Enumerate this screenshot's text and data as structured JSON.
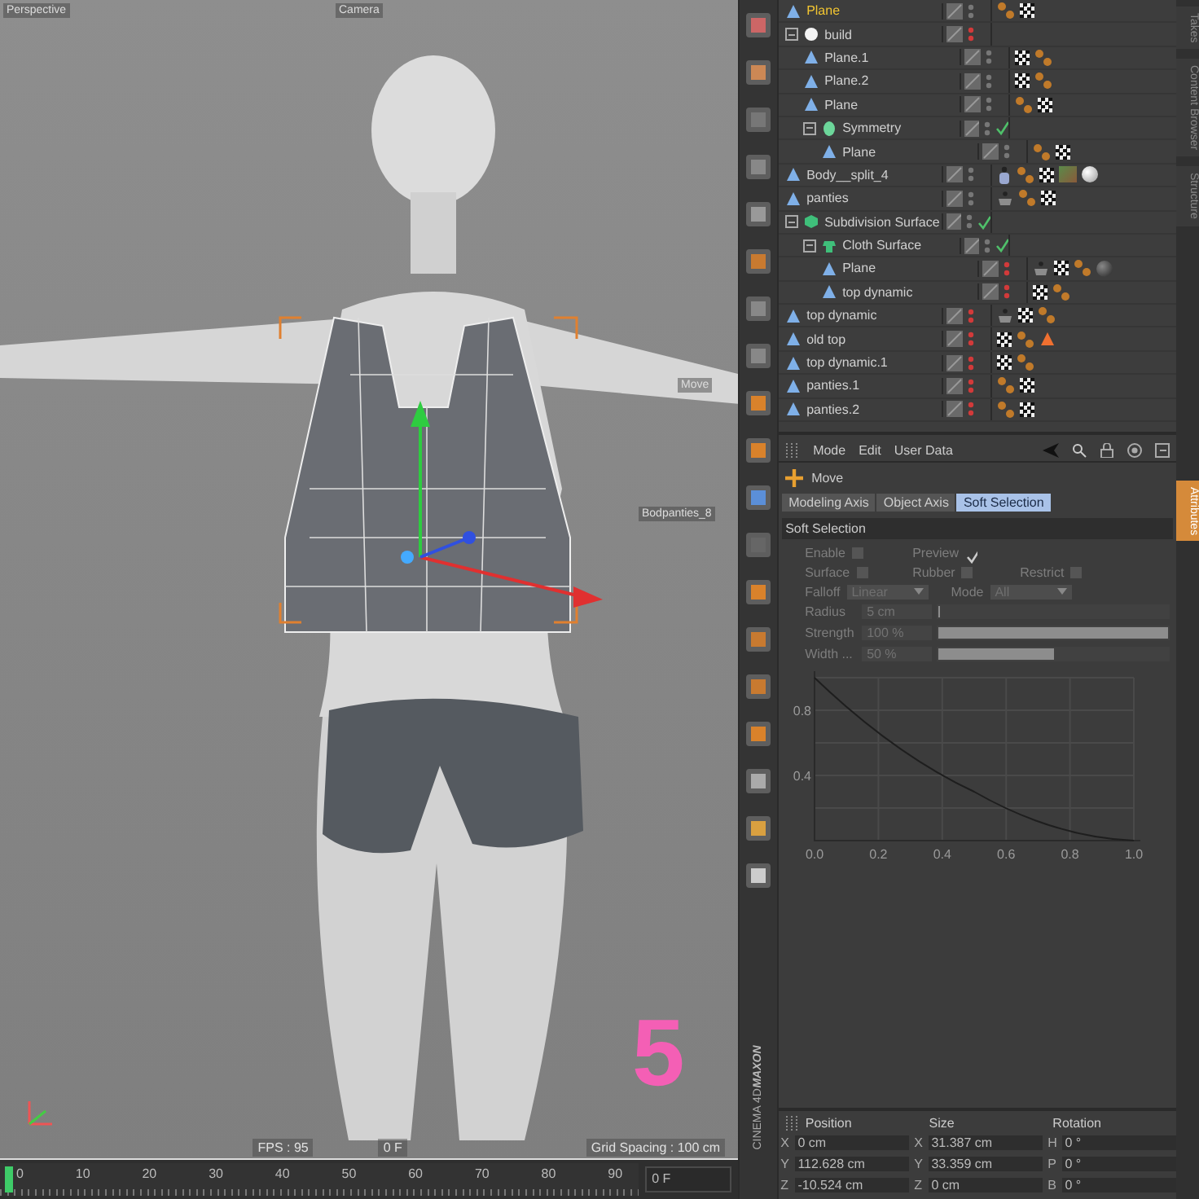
{
  "viewport": {
    "view_name": "Perspective",
    "camera_label": "Camera",
    "handle_label": "Move",
    "object_label": "Bodpanties_8",
    "fps": "FPS : 95",
    "frame": "0 F",
    "grid_spacing": "Grid Spacing : 100 cm",
    "overlay_number": "5"
  },
  "timeline": {
    "ticks": [
      "0",
      "10",
      "20",
      "30",
      "40",
      "50",
      "60",
      "70",
      "80",
      "90"
    ],
    "level": 0,
    "frame_field": "0 F"
  },
  "logo": [
    "MAXON",
    "CINEMA 4D"
  ],
  "objects": [
    {
      "name": "Plane",
      "kind": "plane",
      "selected": true,
      "hidden": false,
      "tags": [
        {
          "kind": "dots"
        },
        {
          "kind": "checker"
        }
      ]
    },
    {
      "name": "build",
      "kind": "null",
      "selected": false,
      "hidden": true,
      "expanded": true,
      "children": [
        {
          "name": "Plane.1",
          "kind": "plane",
          "selected": false,
          "hidden": false,
          "tags": [
            {
              "kind": "checker"
            },
            {
              "kind": "dots"
            }
          ]
        },
        {
          "name": "Plane.2",
          "kind": "plane",
          "selected": false,
          "hidden": false,
          "tags": [
            {
              "kind": "checker"
            },
            {
              "kind": "dots"
            }
          ]
        },
        {
          "name": "Plane",
          "kind": "plane",
          "selected": false,
          "hidden": false,
          "tags": [
            {
              "kind": "dots"
            },
            {
              "kind": "checker"
            }
          ]
        },
        {
          "name": "Symmetry",
          "kind": "symmetry",
          "selected": false,
          "hidden": false,
          "enabled": true,
          "expanded": true,
          "children": [
            {
              "name": "Plane",
              "kind": "plane",
              "selected": false,
              "hidden": false,
              "tags": [
                {
                  "kind": "dots"
                },
                {
                  "kind": "checker"
                }
              ]
            }
          ]
        }
      ]
    },
    {
      "name": "Body__split_4",
      "kind": "plane",
      "selected": false,
      "hidden": false,
      "tags": [
        {
          "kind": "figure"
        },
        {
          "kind": "dots"
        },
        {
          "kind": "checker"
        },
        {
          "kind": "texture"
        },
        {
          "kind": "sphere"
        }
      ]
    },
    {
      "name": "panties",
      "kind": "plane",
      "selected": false,
      "hidden": false,
      "tags": [
        {
          "kind": "cloth"
        },
        {
          "kind": "dots"
        },
        {
          "kind": "checker"
        }
      ]
    },
    {
      "name": "Subdivision Surface",
      "kind": "subdivision",
      "selected": false,
      "hidden": false,
      "enabled": true,
      "expanded": true,
      "children": [
        {
          "name": "Cloth Surface",
          "kind": "cloth",
          "selected": false,
          "hidden": false,
          "enabled": true,
          "expanded": true,
          "children": [
            {
              "name": "Plane",
              "kind": "plane",
              "selected": false,
              "hidden": true,
              "tags": [
                {
                  "kind": "cloth"
                },
                {
                  "kind": "checker"
                },
                {
                  "kind": "dots"
                },
                {
                  "kind": "dark-sphere"
                }
              ]
            },
            {
              "name": "top dynamic",
              "kind": "plane",
              "selected": false,
              "hidden": true,
              "tags": [
                {
                  "kind": "checker"
                },
                {
                  "kind": "dots"
                }
              ]
            }
          ]
        }
      ]
    },
    {
      "name": "top dynamic",
      "kind": "plane",
      "selected": false,
      "hidden": true,
      "tags": [
        {
          "kind": "cloth"
        },
        {
          "kind": "checker"
        },
        {
          "kind": "dots"
        }
      ]
    },
    {
      "name": "old top",
      "kind": "plane",
      "selected": false,
      "hidden": true,
      "tags": [
        {
          "kind": "checker"
        },
        {
          "kind": "dots"
        },
        {
          "kind": "cone"
        }
      ]
    },
    {
      "name": "top dynamic.1",
      "kind": "plane",
      "selected": false,
      "hidden": true,
      "tags": [
        {
          "kind": "checker"
        },
        {
          "kind": "dots"
        }
      ]
    },
    {
      "name": "panties.1",
      "kind": "plane",
      "selected": false,
      "hidden": true,
      "tags": [
        {
          "kind": "dots"
        },
        {
          "kind": "checker"
        }
      ]
    },
    {
      "name": "panties.2",
      "kind": "plane",
      "selected": false,
      "hidden": true,
      "tags": [
        {
          "kind": "dots"
        },
        {
          "kind": "checker"
        }
      ]
    }
  ],
  "side_tabs": [
    {
      "label": "Takes",
      "selected": false
    },
    {
      "label": "Content Browser",
      "selected": false
    },
    {
      "label": "Structure",
      "selected": false
    },
    {
      "label": "Attributes",
      "selected": true
    }
  ],
  "attributes": {
    "menu": [
      "Mode",
      "Edit",
      "User Data"
    ],
    "tool": "Move",
    "tabs": [
      {
        "label": "Modeling Axis",
        "selected": false
      },
      {
        "label": "Object Axis",
        "selected": false
      },
      {
        "label": "Soft Selection",
        "selected": true
      }
    ],
    "section": "Soft Selection",
    "checks": [
      [
        {
          "label": "Enable",
          "checked": false
        },
        {
          "label": "Preview",
          "checked": true
        }
      ],
      [
        {
          "label": "Surface",
          "checked": false
        },
        {
          "label": "Rubber",
          "checked": false
        },
        {
          "label": "Restrict",
          "checked": false
        }
      ]
    ],
    "dropdowns": [
      {
        "label": "Falloff",
        "value": "Linear"
      },
      {
        "label": "Mode",
        "value": "All"
      }
    ],
    "sliders": [
      {
        "label": "Radius",
        "value": "5 cm",
        "level": 0
      },
      {
        "label": "Strength",
        "value": "100 %",
        "level": 1
      },
      {
        "label": "Width ...",
        "value": "50 %",
        "level": 0.5
      }
    ],
    "chart_data": {
      "type": "line",
      "x": [
        0,
        0.5,
        1
      ],
      "series": [
        {
          "color": "#1e1e1e",
          "values": [
            1,
            0.3,
            0
          ]
        }
      ],
      "xlim": [
        0,
        1
      ],
      "ylim": [
        0,
        1
      ],
      "grid": true,
      "xticks": [
        {
          "value": 0,
          "label": "0.0"
        },
        {
          "value": 0.2,
          "label": "0.2"
        },
        {
          "value": 0.4,
          "label": "0.4"
        },
        {
          "value": 0.6,
          "label": "0.6"
        },
        {
          "value": 0.8,
          "label": "0.8"
        },
        {
          "value": 1,
          "label": "1.0"
        }
      ],
      "yticks": [
        {
          "value": 0.4,
          "label": "0.4"
        },
        {
          "value": 0.8,
          "label": "0.8"
        }
      ]
    }
  },
  "coordinates": {
    "headers": [
      "Position",
      "Size",
      "Rotation"
    ],
    "rows": [
      [
        {
          "axis": "X",
          "value": "0 cm"
        },
        {
          "axis": "X",
          "value": "31.387 cm"
        },
        {
          "axis": "H",
          "value": "0 °"
        }
      ],
      [
        {
          "axis": "Y",
          "value": "112.628 cm"
        },
        {
          "axis": "Y",
          "value": "33.359 cm"
        },
        {
          "axis": "P",
          "value": "0 °"
        }
      ],
      [
        {
          "axis": "Z",
          "value": "-10.524 cm"
        },
        {
          "axis": "Z",
          "value": "0 cm"
        },
        {
          "axis": "B",
          "value": "0 °"
        }
      ]
    ]
  }
}
